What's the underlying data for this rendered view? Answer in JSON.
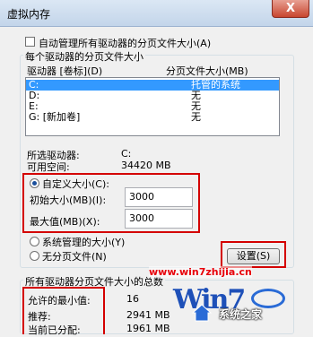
{
  "window": {
    "title": "虚拟内存",
    "close_glyph": "X"
  },
  "auto_manage": {
    "label": "自动管理所有驱动器的分页文件大小(A)",
    "checked": false
  },
  "drives_group": {
    "title": "每个驱动器的分页文件大小",
    "col_drive": "驱动器 [卷标](D)",
    "col_size": "分页文件大小(MB)",
    "rows": [
      {
        "drive": "C:",
        "type": "托管的系统",
        "selected": true
      },
      {
        "drive": "D:",
        "type": "无",
        "selected": false
      },
      {
        "drive": "E:",
        "type": "无",
        "selected": false
      },
      {
        "drive": "G:      [新加卷]",
        "type": "无",
        "selected": false
      }
    ],
    "selected_drive_label": "所选驱动器:",
    "selected_drive_value": "C:",
    "free_space_label": "可用空间:",
    "free_space_value": "34420 MB",
    "custom_size_label": "自定义大小(C):",
    "initial_size_label": "初始大小(MB)(I):",
    "initial_size_value": "3000",
    "max_size_label": "最大值(MB)(X):",
    "max_size_value": "3000",
    "system_managed_label": "系统管理的大小(Y)",
    "no_paging_label": "无分页文件(N)",
    "set_button": "设置(S)"
  },
  "total_group": {
    "title": "所有驱动器分页文件大小的总数",
    "min_label": "允许的最小值:",
    "min_value": "16",
    "recommended_label": "推荐:",
    "recommended_value": "2941 MB",
    "current_label": "当前已分配:",
    "current_value": "1961 MB"
  },
  "watermark": {
    "url": "www.win7zhijia.cn",
    "logo_text": "Win7",
    "site": "系统之家"
  },
  "colors": {
    "selection": "#3399ff",
    "highlight_box": "#d40000"
  }
}
